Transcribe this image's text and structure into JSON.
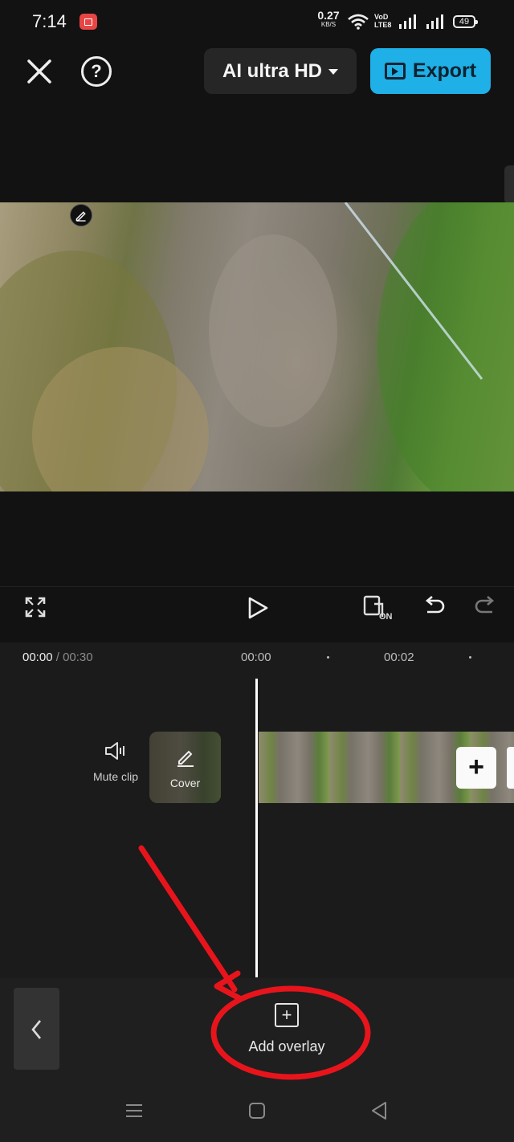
{
  "status_bar": {
    "time": "7:14",
    "net_speed_value": "0.27",
    "net_speed_unit": "KB/S",
    "volte_top": "VoD",
    "volte_bottom": "LTE8",
    "battery": "49"
  },
  "toolbar": {
    "quality_label": "AI ultra HD",
    "export_label": "Export"
  },
  "help_icon": "?",
  "compare_badge": "ON",
  "timeline": {
    "current_time": "00:00",
    "separator": " / ",
    "total_time": "00:30",
    "ruler_ticks": [
      "00:00",
      "00:02"
    ]
  },
  "track": {
    "mute_label": "Mute clip",
    "cover_label": "Cover",
    "add_clip": "+"
  },
  "bottom_toolbar": {
    "add_overlay_label": "Add overlay",
    "add_overlay_glyph": "+"
  },
  "annotation_color": "#e8141c",
  "accent_color": "#1eb0e6",
  "icons": [
    "close-icon",
    "help-icon",
    "caret-down-icon",
    "export-icon",
    "pencil-icon",
    "fullscreen-icon",
    "play-icon",
    "compare-icon",
    "undo-icon",
    "redo-icon",
    "speaker-icon",
    "pencil-icon",
    "plus-icon",
    "chevron-left-icon",
    "add-overlay-icon",
    "menu-icon",
    "home-icon",
    "back-icon"
  ]
}
